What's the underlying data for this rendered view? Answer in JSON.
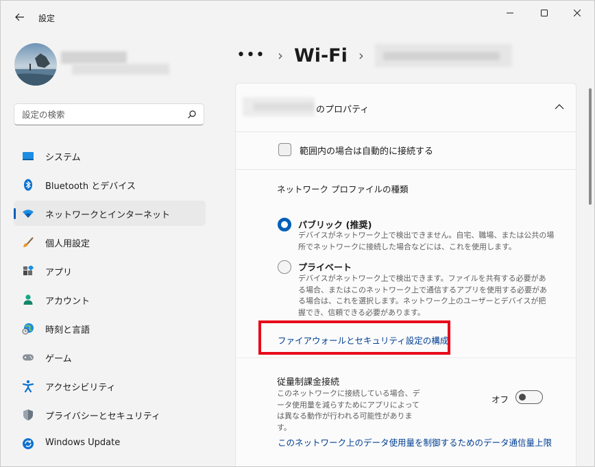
{
  "window": {
    "title": "設定"
  },
  "search": {
    "placeholder": "設定の検索"
  },
  "sidebar": {
    "items": [
      {
        "label": "システム",
        "icon": "monitor-icon"
      },
      {
        "label": "Bluetooth とデバイス",
        "icon": "bluetooth-icon"
      },
      {
        "label": "ネットワークとインターネット",
        "icon": "wifi-icon",
        "selected": true
      },
      {
        "label": "個人用設定",
        "icon": "brush-icon"
      },
      {
        "label": "アプリ",
        "icon": "apps-icon"
      },
      {
        "label": "アカウント",
        "icon": "person-icon"
      },
      {
        "label": "時刻と言語",
        "icon": "globe-clock-icon"
      },
      {
        "label": "ゲーム",
        "icon": "gamepad-icon"
      },
      {
        "label": "アクセシビリティ",
        "icon": "accessibility-icon"
      },
      {
        "label": "プライバシーとセキュリティ",
        "icon": "shield-icon"
      },
      {
        "label": "Windows Update",
        "icon": "update-icon"
      }
    ]
  },
  "breadcrumb": {
    "more": "•••",
    "current": "Wi-Fi"
  },
  "properties": {
    "title_suffix": "のプロパティ",
    "auto_connect_label": "範囲内の場合は自動的に接続する",
    "auto_connect_checked": false,
    "profile_section_title": "ネットワーク プロファイルの種類",
    "public_title": "パブリック (推奨)",
    "public_desc": "デバイスがネットワーク上で検出できません。自宅、職場、または公共の場所でネットワークに接続した場合などには、これを使用します。",
    "public_selected": true,
    "private_title": "プライベート",
    "private_desc": "デバイスがネットワーク上で検出できます。ファイルを共有する必要がある場合、またはこのネットワーク上で通信するアプリを使用する必要がある場合は、これを選択します。ネットワーク上のユーザーとデバイスが把握でき、信頼できる必要があります。",
    "firewall_link": "ファイアウォールとセキュリティ設定の構成",
    "metered_title": "従量制課金接続",
    "metered_desc": "このネットワークに接続している場合、データ使用量を減らすためにアプリによっては異なる動作が行われる可能性があります。",
    "metered_state_label": "オフ",
    "metered_on": false,
    "data_limit_link": "このネットワーク上のデータ使用量を制御するためのデータ通信量上限"
  },
  "colors": {
    "accent": "#005fb8",
    "link": "#003e92",
    "highlight": "#e8091a"
  }
}
